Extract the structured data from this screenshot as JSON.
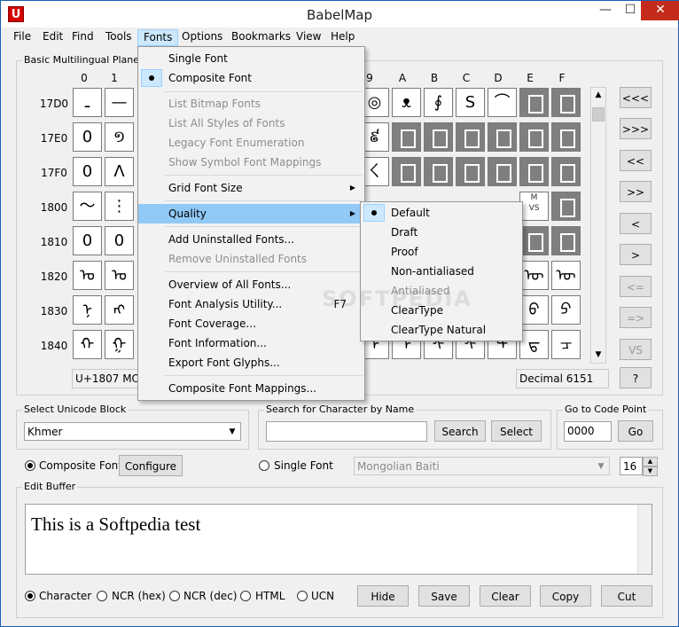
{
  "window": {
    "title": "BabelMap",
    "app_icon_letter": "U",
    "controls": {
      "minimize": "—",
      "maximize": "☐",
      "close": "✕"
    }
  },
  "menubar": {
    "items": [
      "File",
      "Edit",
      "Find",
      "Tools",
      "Fonts",
      "Options",
      "Bookmarks",
      "View",
      "Help"
    ],
    "active": "Fonts"
  },
  "grid": {
    "group_label": "Basic Multilingual Plane : Kh",
    "visible_col_heads": [
      "0",
      "1",
      "9",
      "A",
      "B",
      "C",
      "D",
      "E",
      "F"
    ],
    "row_heads": [
      "17D0",
      "17E0",
      "17F0",
      "1800",
      "1810",
      "1820",
      "1830",
      "1840"
    ],
    "codepoint_status": "U+1807 MONG",
    "decimal_status": "Decimal 6151"
  },
  "nav_buttons": [
    "<<<",
    ">>>",
    "<<",
    ">>",
    "<",
    ">",
    "<=",
    "=>",
    "VS",
    "?"
  ],
  "unicode_block": {
    "label": "Select Unicode Block",
    "value": "Khmer"
  },
  "search": {
    "label": "Search for Character by Name",
    "value": "",
    "search_button": "Search",
    "select_button": "Select"
  },
  "goto": {
    "label": "Go to Code Point",
    "value": "0000",
    "button": "Go"
  },
  "font_mode": {
    "composite_label": "Composite Font",
    "configure_button": "Configure",
    "single_label": "Single Font",
    "single_font_value": "Mongolian Baiti",
    "font_size": "16"
  },
  "edit_buffer": {
    "label": "Edit Buffer",
    "text": "This  is a Softpedia test"
  },
  "output_format": {
    "options": [
      "Character",
      "NCR (hex)",
      "NCR (dec)",
      "HTML",
      "UCN"
    ],
    "selected": "Character"
  },
  "buffer_buttons": [
    "Hide",
    "Save",
    "Clear",
    "Copy",
    "Cut"
  ],
  "fonts_menu": {
    "items": [
      {
        "label": "Single Font",
        "state": "enabled"
      },
      {
        "label": "Composite Font",
        "state": "checked"
      },
      {
        "label": "List Bitmap Fonts",
        "state": "disabled"
      },
      {
        "label": "List All Styles of Fonts",
        "state": "disabled"
      },
      {
        "label": "Legacy Font Enumeration",
        "state": "disabled"
      },
      {
        "label": "Show Symbol Font Mappings",
        "state": "disabled"
      },
      {
        "label": "Grid Font Size",
        "state": "submenu"
      },
      {
        "label": "Quality",
        "state": "submenu-highlight"
      },
      {
        "label": "Add Uninstalled Fonts...",
        "state": "enabled"
      },
      {
        "label": "Remove Uninstalled Fonts",
        "state": "disabled"
      },
      {
        "label": "Overview of All Fonts...",
        "state": "enabled"
      },
      {
        "label": "Font Analysis Utility...",
        "state": "enabled",
        "shortcut": "F7"
      },
      {
        "label": "Font Coverage...",
        "state": "enabled"
      },
      {
        "label": "Font Information...",
        "state": "enabled"
      },
      {
        "label": "Export Font Glyphs...",
        "state": "enabled"
      },
      {
        "label": "Composite Font Mappings...",
        "state": "enabled"
      }
    ]
  },
  "quality_submenu": {
    "items": [
      {
        "label": "Default",
        "state": "checked"
      },
      {
        "label": "Draft",
        "state": "enabled"
      },
      {
        "label": "Proof",
        "state": "enabled"
      },
      {
        "label": "Non-antialiased",
        "state": "enabled"
      },
      {
        "label": "Antialiased",
        "state": "disabled"
      },
      {
        "label": "ClearType",
        "state": "enabled"
      },
      {
        "label": "ClearType Natural",
        "state": "enabled"
      }
    ]
  },
  "glyphs": {
    "r0": [
      "ـ",
      "—",
      "◎",
      "ᴥ",
      "∮",
      "S",
      "⌒"
    ],
    "r1": [
      "0",
      "១",
      "៩"
    ],
    "r2": [
      "0",
      "Λ",
      "ㄑ"
    ],
    "r3": [
      "〜",
      "⋮",
      "ᠠ",
      "ᠡ",
      "ᠢ"
    ],
    "r4": [
      "0",
      "0"
    ],
    "r5": [
      "ᠣ",
      "ᠤ",
      "ᠥ",
      "ᠦ",
      "ᠧ"
    ],
    "r6": [
      "ᠨ",
      "ᠩ",
      "ᠪ",
      "ᠫ"
    ],
    "r7": [
      "ᠬ",
      "ᠭ",
      "ᠮ",
      "ᠯ",
      "ᠰ",
      "ᠱ",
      "ᠲ",
      "ᠳ",
      "ᠴ"
    ]
  },
  "watermark": "SOFTPEDIA"
}
